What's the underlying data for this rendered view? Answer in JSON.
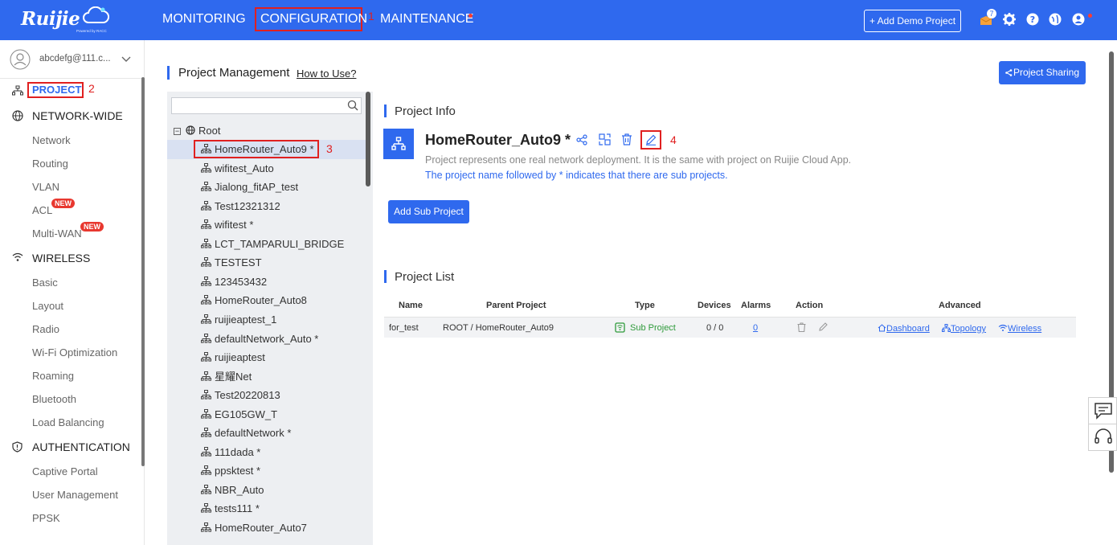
{
  "header": {
    "logo_text": "Ruijie",
    "logo_sub": "Powered by RACC",
    "nav": [
      "MONITORING",
      "CONFIGURATION",
      "MAINTENANCE"
    ],
    "add_demo_label": "+ Add Demo Project",
    "notification_count": "7",
    "marks": {
      "config": "1"
    }
  },
  "sidebar": {
    "user_email": "abcdefg@111.c...",
    "project_label": "PROJECT",
    "project_mark": "2",
    "sections": [
      {
        "title": "NETWORK-WIDE",
        "items": [
          "Network",
          "Routing",
          "VLAN",
          "ACL",
          "Multi-WAN"
        ]
      },
      {
        "title": "WIRELESS",
        "items": [
          "Basic",
          "Layout",
          "Radio",
          "Wi-Fi Optimization",
          "Roaming",
          "Bluetooth",
          "Load Balancing"
        ]
      },
      {
        "title": "AUTHENTICATION",
        "items": [
          "Captive Portal",
          "User Management",
          "PPSK"
        ]
      }
    ],
    "new_badge": "NEW"
  },
  "main": {
    "title": "Project Management",
    "how_to": "How to Use?",
    "share_label": "Project Sharing",
    "tree": {
      "root": "Root",
      "items": [
        "HomeRouter_Auto9 *",
        "wifitest_Auto",
        "Jialong_fitAP_test",
        "Test12321312",
        "wifitest *",
        "LCT_TAMPARULI_BRIDGE",
        "TESTEST",
        "123453432",
        "HomeRouter_Auto8",
        "ruijieaptest_1",
        "defaultNetwork_Auto *",
        "ruijieaptest",
        "星耀Net",
        "Test20220813",
        "EG105GW_T",
        "defaultNetwork *",
        "111dada *",
        "ppsktest *",
        "NBR_Auto",
        "tests111 *",
        "HomeRouter_Auto7"
      ],
      "selected_mark": "3"
    },
    "info": {
      "section_title": "Project Info",
      "name": "HomeRouter_Auto9 *",
      "edit_mark": "4",
      "desc1": "Project represents one real network deployment. It is the same with project on Ruijie Cloud App.",
      "desc2": "The project name followed by * indicates that there are sub projects.",
      "add_sub_label": "Add Sub Project"
    },
    "list": {
      "section_title": "Project List",
      "headers": [
        "Name",
        "Parent Project",
        "Type",
        "Devices",
        "Alarms",
        "Action",
        "Advanced"
      ],
      "rows": [
        {
          "name": "for_test",
          "parent": "ROOT / HomeRouter_Auto9",
          "type": "Sub Project",
          "devices": "0 / 0",
          "alarms": "0",
          "links": [
            "Dashboard",
            "Topology",
            "Wireless"
          ]
        }
      ]
    }
  },
  "colors": {
    "brand": "#2f69ee",
    "highlight": "#e02020",
    "success": "#2e9a3a"
  }
}
